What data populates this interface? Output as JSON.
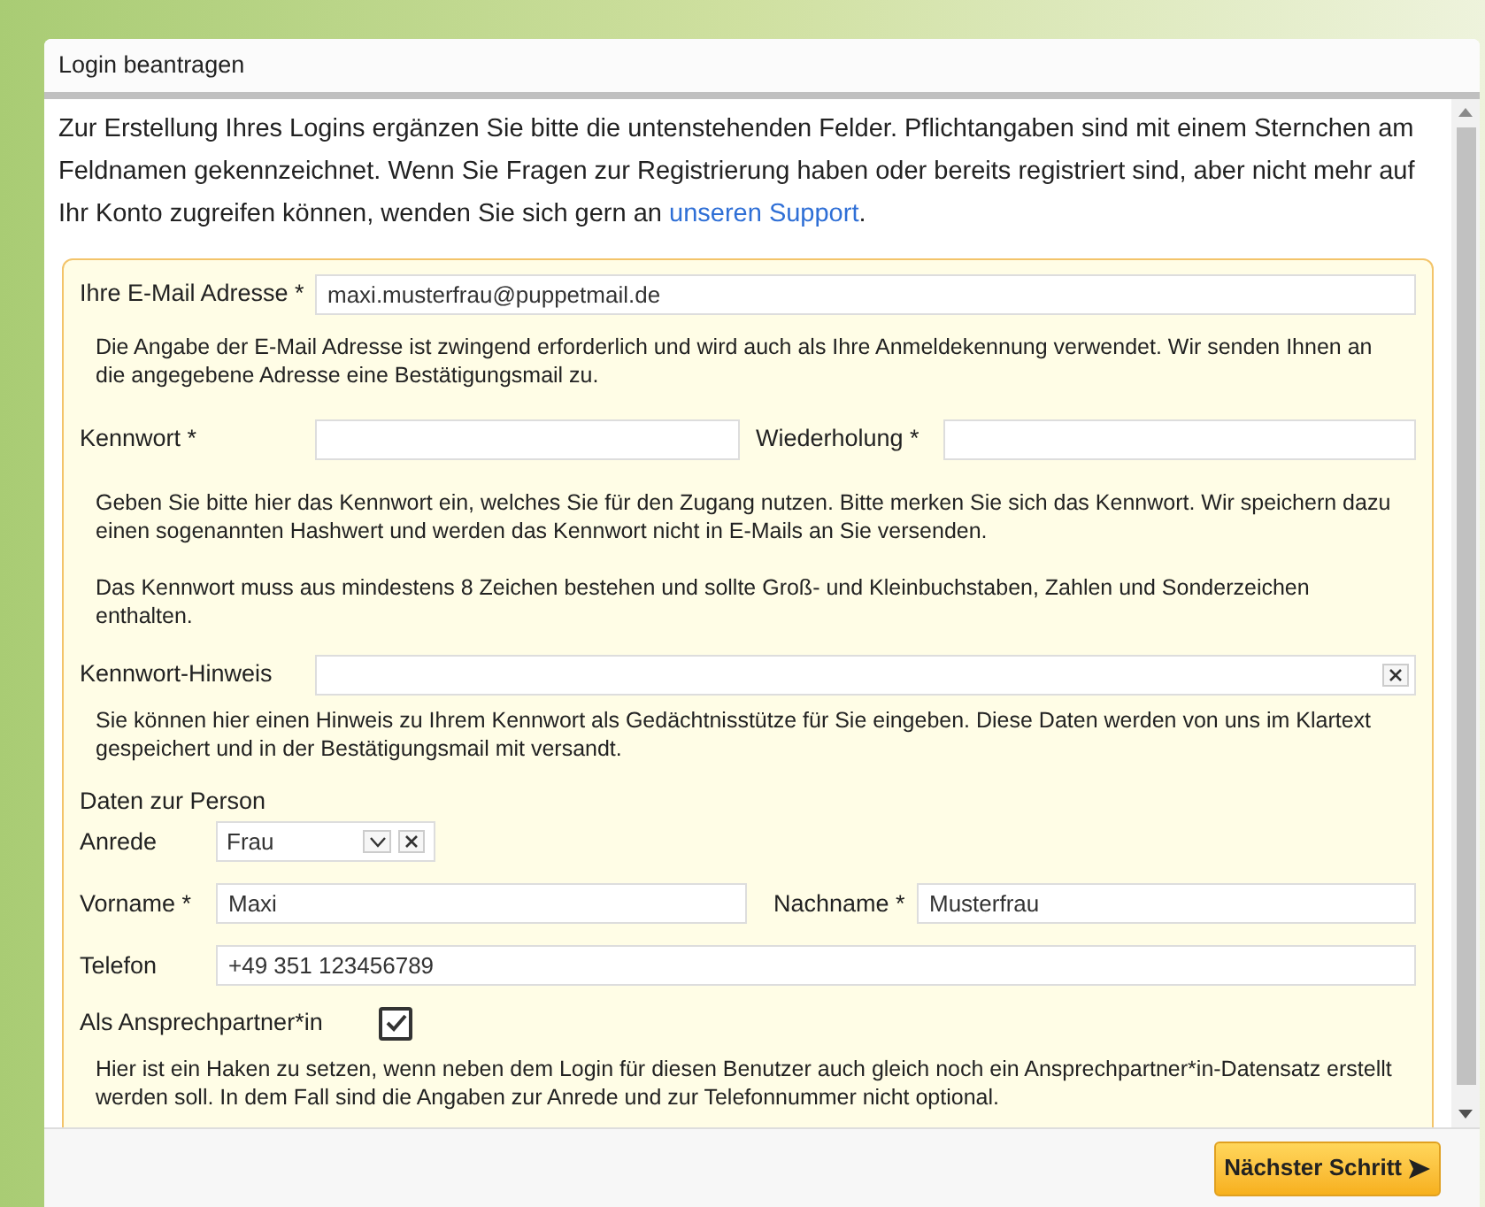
{
  "dialog": {
    "title": "Login beantragen"
  },
  "intro": {
    "text": "Zur Erstellung Ihres Logins ergänzen Sie bitte die untenstehenden Felder. Pflichtangaben sind mit einem Sternchen am Feldnamen gekennzeichnet. Wenn Sie Fragen zur Registrierung haben oder bereits registriert sind, aber nicht mehr auf Ihr Konto zugreifen können, wenden Sie sich gern an ",
    "link": "unseren Support",
    "after": "."
  },
  "form": {
    "email": {
      "label": "Ihre E-Mail Adresse *",
      "value": "maxi.musterfrau@puppetmail.de",
      "help": "Die Angabe der E-Mail Adresse ist zwingend erforderlich und wird auch als Ihre Anmeldekennung verwendet. Wir senden Ihnen an die angegebene Adresse eine Bestätigungsmail zu."
    },
    "password": {
      "label": "Kennwort *",
      "repeat_label": "Wiederholung *",
      "help": [
        "Geben Sie bitte hier das Kennwort ein, welches Sie für den Zugang nutzen. Bitte merken Sie sich das Kennwort. Wir speichern dazu einen sogenannten Hashwert und werden das Kennwort nicht in E-Mails an Sie versenden.",
        "Das Kennwort muss aus mindestens 8 Zeichen bestehen und sollte Groß- und Kleinbuchstaben, Zahlen und Sonderzeichen enthalten."
      ]
    },
    "hint": {
      "label": "Kennwort-Hinweis",
      "help": "Sie können hier einen Hinweis zu Ihrem Kennwort als Gedächtnisstütze für Sie eingeben. Diese Daten werden von uns im Klartext gespeichert und in der Bestätigungsmail mit versandt."
    },
    "person": {
      "heading": "Daten zur Person",
      "salutation": {
        "label": "Anrede",
        "value": "Frau"
      },
      "first_name": {
        "label": "Vorname *",
        "value": "Maxi"
      },
      "last_name": {
        "label": "Nachname *",
        "value": "Musterfrau"
      },
      "phone": {
        "label": "Telefon",
        "value": "+49 351 123456789"
      }
    },
    "contact": {
      "label": "Als Ansprechpartner*in",
      "checked": true,
      "help": "Hier ist ein Haken zu setzen, wenn neben dem Login für diesen Benutzer auch gleich noch ein Ansprechpartner*in-Datensatz erstellt werden soll. In dem Fall sind die Angaben zur Anrede und zur Telefonnummer nicht optional."
    }
  },
  "footer": {
    "button": "Nächster Schritt"
  }
}
